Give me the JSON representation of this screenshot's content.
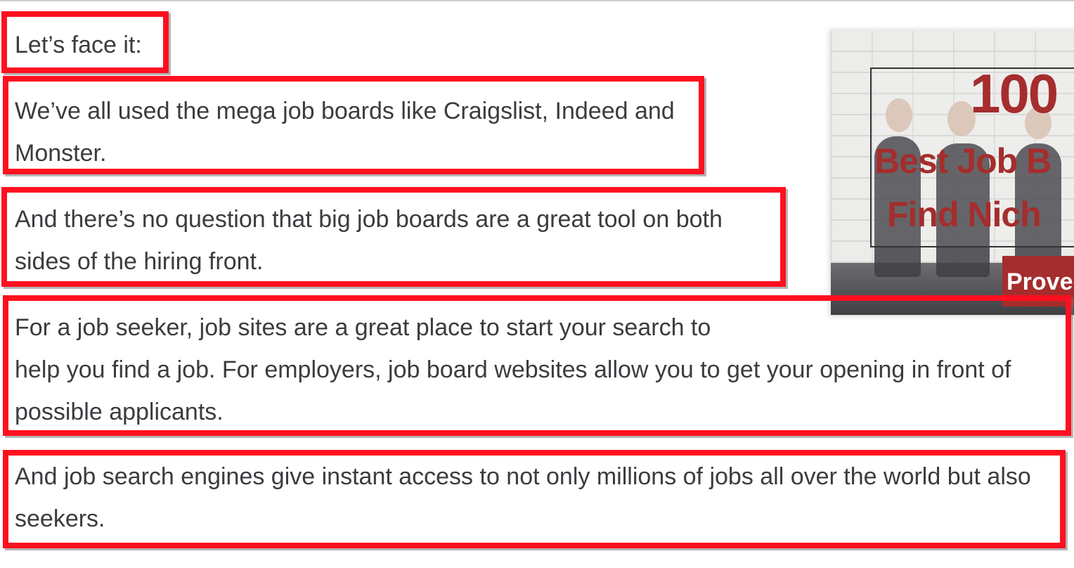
{
  "article": {
    "paragraphs": [
      {
        "lines": [
          "Let’s face it:"
        ]
      },
      {
        "lines": [
          "We’ve all used the mega job boards like Craigslist, Indeed and",
          "Monster."
        ]
      },
      {
        "lines": [
          "And there’s no question that big job boards are a great tool on both",
          "sides of the hiring front."
        ]
      },
      {
        "lines": [
          "For a job seeker, job sites are a great place to start your search to",
          "help you find a job. For employers, job board websites allow you to get your opening in front of",
          "possible applicants."
        ]
      },
      {
        "lines": [
          "And job search engines give instant access to not only millions of jobs all over the world but also",
          "seekers."
        ]
      }
    ]
  },
  "promo": {
    "number": "100",
    "line1": "Best Job B",
    "line2": "Find Nich",
    "cta": "Prove"
  },
  "colors": {
    "highlight": "#ff1020",
    "promo_red": "#a52d2d",
    "text": "#3b3b40"
  }
}
